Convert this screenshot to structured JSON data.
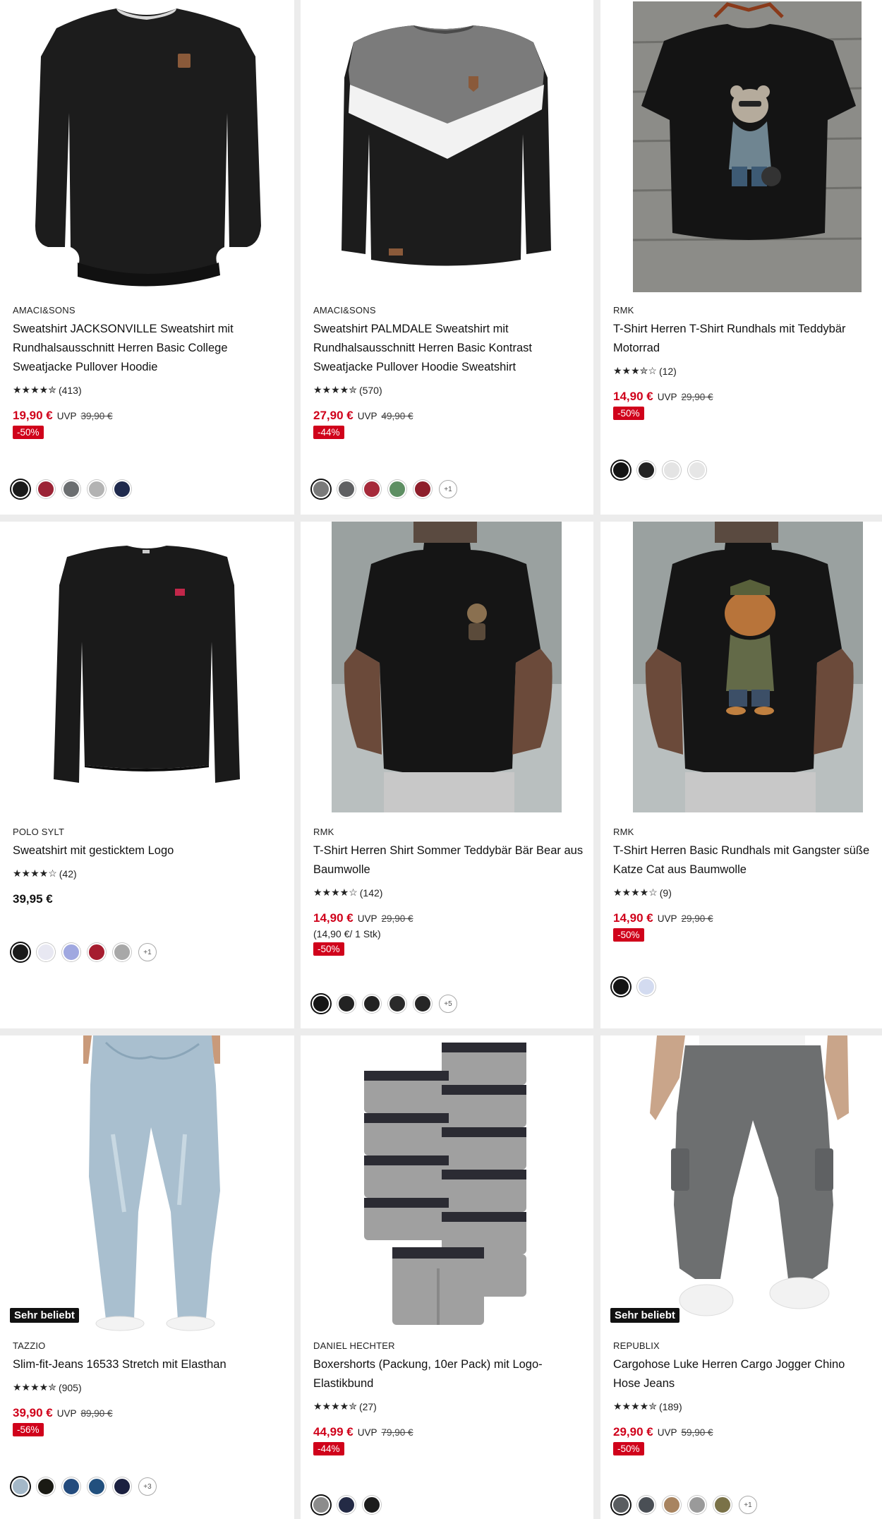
{
  "products": [
    {
      "brand": "AMACI&SONS",
      "title": "Sweatshirt JACKSONVILLE Sweatshirt mit Rundhalsausschnitt Herren Basic College Sweatjacke Pullover Hoodie",
      "stars": "★★★★✮",
      "reviews": "(413)",
      "price": "19,90 €",
      "uvp_label": "UVP",
      "uvp_price": "39,90 €",
      "discount": "-50%",
      "swatches": [
        "#1a1a1a",
        "#9b2335",
        "#6b6e70",
        "#b3b3b3",
        "#1f2a4d"
      ],
      "more": ""
    },
    {
      "brand": "AMACI&SONS",
      "title": "Sweatshirt PALMDALE Sweatshirt mit Rundhalsausschnitt Herren Basic Kontrast Sweatjacke Pullover Hoodie Sweatshirt",
      "stars": "★★★★✮",
      "reviews": "(570)",
      "price": "27,90 €",
      "uvp_label": "UVP",
      "uvp_price": "49,90 €",
      "discount": "-44%",
      "swatches": [
        "#7a7a7a",
        "#5f6062",
        "#a62a3a",
        "#5e8f63",
        "#8e1f2b"
      ],
      "more": "+1"
    },
    {
      "brand": "RMK",
      "title": "T-Shirt Herren T-Shirt Rundhals mit Teddybär Motorrad",
      "stars": "★★★✮☆",
      "reviews": "(12)",
      "price": "14,90 €",
      "uvp_label": "UVP",
      "uvp_price": "29,90 €",
      "discount": "-50%",
      "swatches": [
        "#151515",
        "#222222",
        "#e4e4e4",
        "#e6e6e6"
      ],
      "more": ""
    },
    {
      "brand": "POLO SYLT",
      "title": "Sweatshirt mit gesticktem Logo",
      "stars": "★★★★☆",
      "reviews": "(42)",
      "price": "39,95 €",
      "uvp_label": "",
      "uvp_price": "",
      "discount": "",
      "swatches": [
        "#1a1a1a",
        "#e8e8f2",
        "#a0a8e0",
        "#a61d2f",
        "#a8a8a8"
      ],
      "more": "+1"
    },
    {
      "brand": "RMK",
      "title": "T-Shirt Herren Shirt Sommer Teddybär Bär Bear aus Baumwolle",
      "stars": "★★★★☆",
      "reviews": "(142)",
      "price": "14,90 €",
      "uvp_label": "UVP",
      "uvp_price": "29,90 €",
      "unit_price": "(14,90 €/ 1 Stk)",
      "discount": "-50%",
      "swatches": [
        "#151515",
        "#222222",
        "#222222",
        "#2a2a2a",
        "#262626"
      ],
      "more": "+5"
    },
    {
      "brand": "RMK",
      "title": "T-Shirt Herren Basic Rundhals mit Gangster süße Katze Cat aus Baumwolle",
      "stars": "★★★★☆",
      "reviews": "(9)",
      "price": "14,90 €",
      "uvp_label": "UVP",
      "uvp_price": "29,90 €",
      "discount": "-50%",
      "swatches": [
        "#151515",
        "#d3dbf0"
      ],
      "more": ""
    },
    {
      "brand": "TAZZIO",
      "title": "Slim-fit-Jeans 16533 Stretch mit Elasthan",
      "badge": "Sehr beliebt",
      "stars": "★★★★✮",
      "reviews": "(905)",
      "price": "39,90 €",
      "uvp_label": "UVP",
      "uvp_price": "89,90 €",
      "discount": "-56%",
      "swatches": [
        "#a4b8c8",
        "#1a1a14",
        "#234b7d",
        "#22507e",
        "#1b2040"
      ],
      "more": "+3"
    },
    {
      "brand": "DANIEL HECHTER",
      "title": "Boxershorts (Packung, 10er Pack) mit Logo-Elastikbund",
      "stars": "★★★★✮",
      "reviews": "(27)",
      "price": "44,99 €",
      "uvp_label": "UVP",
      "uvp_price": "79,90 €",
      "discount": "-44%",
      "swatches": [
        "#8c8c8c",
        "#232a45",
        "#1c1c1c"
      ],
      "more": ""
    },
    {
      "brand": "REPUBLIX",
      "title": "Cargohose Luke Herren Cargo Jogger Chino Hose Jeans",
      "badge": "Sehr beliebt",
      "stars": "★★★★✮",
      "reviews": "(189)",
      "price": "29,90 €",
      "uvp_label": "UVP",
      "uvp_price": "59,90 €",
      "discount": "-50%",
      "swatches": [
        "#5a5d60",
        "#4a4f55",
        "#a88460",
        "#9a9a9a",
        "#7a7248"
      ],
      "more": "+1"
    }
  ]
}
